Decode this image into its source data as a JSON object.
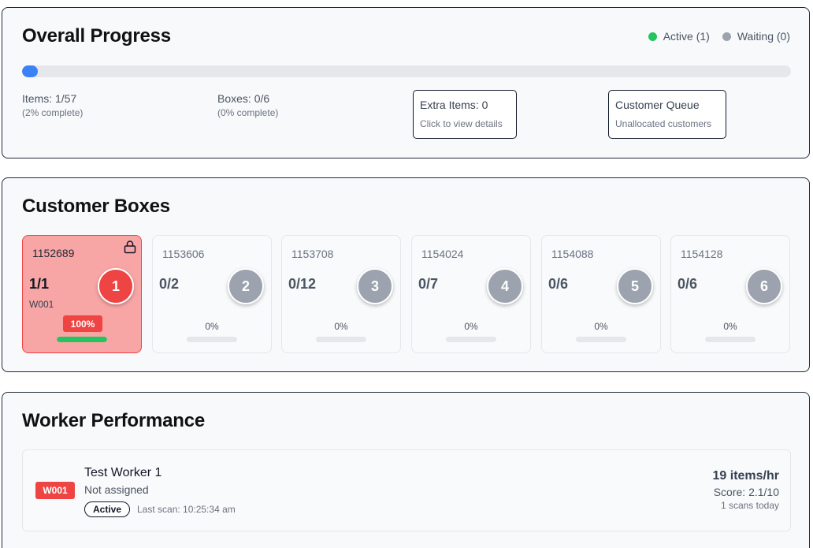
{
  "overall": {
    "title": "Overall Progress",
    "legend": {
      "active_label": "Active (1)",
      "waiting_label": "Waiting (0)",
      "active_color": "#22c55e",
      "waiting_color": "#9ca3af"
    },
    "progress_fraction": 0.02,
    "items": {
      "main": "Items: 1/57",
      "sub": "(2% complete)"
    },
    "boxes": {
      "main": "Boxes: 0/6",
      "sub": "(0% complete)"
    },
    "extra": {
      "main": "Extra Items: 0",
      "sub": "Click to view details"
    },
    "queue": {
      "main": "Customer Queue",
      "sub": "Unallocated customers"
    }
  },
  "customer_boxes": {
    "title": "Customer Boxes",
    "boxes": [
      {
        "id": "1152689",
        "count": "1/1",
        "worker": "W001",
        "number": "1",
        "percent": "100%",
        "fill": 1.0,
        "active": true,
        "icon": "lock-icon"
      },
      {
        "id": "1153606",
        "count": "0/2",
        "worker": "",
        "number": "2",
        "percent": "0%",
        "fill": 0,
        "active": false
      },
      {
        "id": "1153708",
        "count": "0/12",
        "worker": "",
        "number": "3",
        "percent": "0%",
        "fill": 0,
        "active": false
      },
      {
        "id": "1154024",
        "count": "0/7",
        "worker": "",
        "number": "4",
        "percent": "0%",
        "fill": 0,
        "active": false
      },
      {
        "id": "1154088",
        "count": "0/6",
        "worker": "",
        "number": "5",
        "percent": "0%",
        "fill": 0,
        "active": false
      },
      {
        "id": "1154128",
        "count": "0/6",
        "worker": "",
        "number": "6",
        "percent": "0%",
        "fill": 0,
        "active": false
      }
    ]
  },
  "worker_performance": {
    "title": "Worker Performance",
    "workers": [
      {
        "badge": "W001",
        "name": "Test Worker 1",
        "assignment": "Not assigned",
        "status": "Active",
        "last_scan": "Last scan: 10:25:34 am",
        "rate": "19 items/hr",
        "score": "Score: 2.1/10",
        "scans": "1 scans today"
      }
    ]
  }
}
